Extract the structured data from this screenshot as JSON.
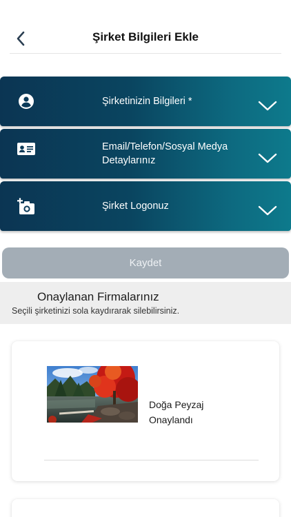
{
  "header": {
    "title": "Şirket Bilgileri Ekle",
    "back_icon": "chevron-left-icon"
  },
  "sections": [
    {
      "label": "Şirketinizin Bilgileri *",
      "icon": "account-circle-icon",
      "chevron": "chevron-down-icon"
    },
    {
      "label": "Email/Telefon/Sosyal Medya Detaylarınız",
      "icon": "contact-card-icon",
      "chevron": "chevron-down-icon"
    },
    {
      "label": "Şirket Logonuz",
      "icon": "add-photo-icon",
      "chevron": "chevron-down-icon"
    }
  ],
  "save_button": {
    "label": "Kaydet"
  },
  "approved": {
    "title": "Onaylanan Firmalarınız",
    "hint": "Seçili şirketinizi sola kaydırarak silebilirsiniz."
  },
  "companies": [
    {
      "name": "Doğa Peyzaj",
      "status": "Onaylandı"
    }
  ],
  "colors": {
    "section_dark": "#0b3553",
    "section_light": "#0d7a8c",
    "button_disabled": "#a3adb6"
  }
}
